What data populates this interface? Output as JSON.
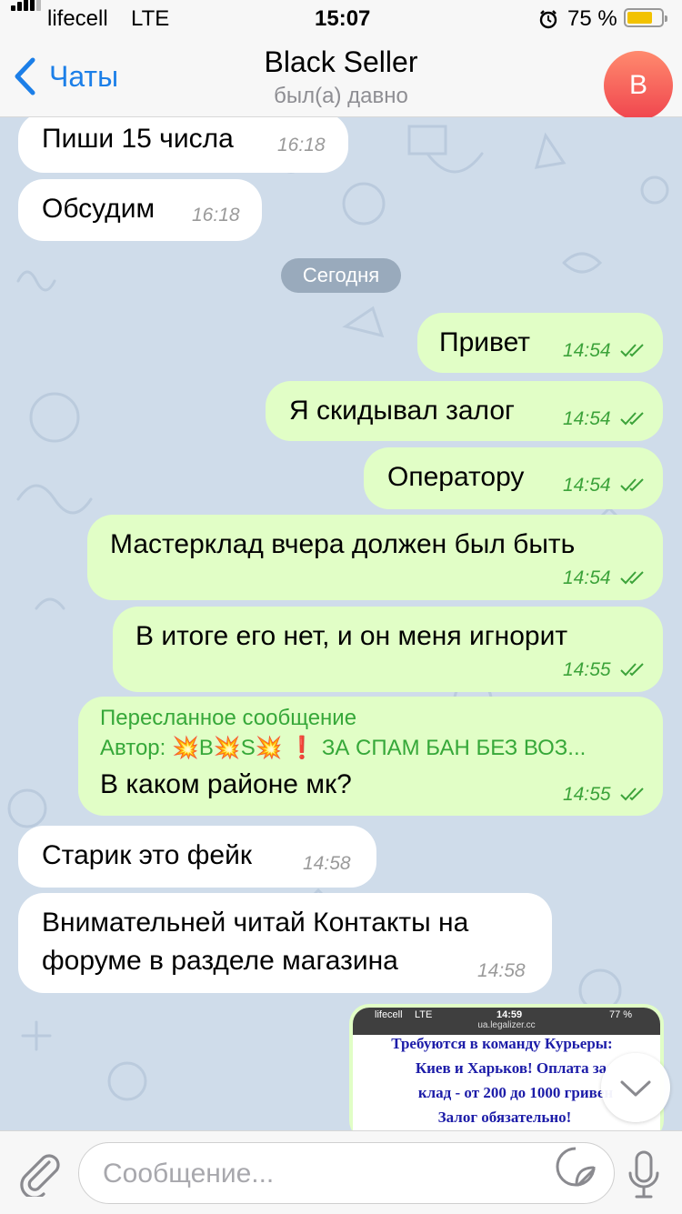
{
  "status_bar": {
    "carrier": "lifecell",
    "network": "LTE",
    "time": "15:07",
    "battery": "75 %",
    "battery_level": 0.75
  },
  "navbar": {
    "back_label": "Чаты",
    "title": "Black Seller",
    "subtitle": "был(а) давно",
    "avatar_letter": "B"
  },
  "date_separator": "Сегодня",
  "messages": [
    {
      "direction": "in",
      "text": "Пиши 15 числа",
      "time": "16:18"
    },
    {
      "direction": "in",
      "text": "Обсудим",
      "time": "16:18"
    },
    {
      "direction": "out",
      "text": "Привет",
      "time": "14:54",
      "read": true
    },
    {
      "direction": "out",
      "text": "Я скидывал залог",
      "time": "14:54",
      "read": true
    },
    {
      "direction": "out",
      "text": "Оператору",
      "time": "14:54",
      "read": true
    },
    {
      "direction": "out",
      "text": "Мастерклад вчера должен был быть",
      "time": "14:54",
      "read": true
    },
    {
      "direction": "out",
      "text": "В итоге его нет, и он меня игнорит",
      "time": "14:55",
      "read": true
    },
    {
      "direction": "out",
      "forwarded_label": "Пересланное сообщение",
      "forwarded_from": "Автор: 💥B💥S💥 ❗ ЗА СПАМ БАН БЕЗ ВОЗ...",
      "text": "В каком районе мк?",
      "time": "14:55",
      "read": true
    },
    {
      "direction": "in",
      "text": "Старик это фейк",
      "time": "14:58"
    },
    {
      "direction": "in",
      "lines": [
        "Внимательней читай Контакты на",
        "форуме в разделе магазина"
      ],
      "time": "14:58"
    }
  ],
  "media_preview": {
    "status_carrier": "lifecell",
    "status_network": "LTE",
    "status_time": "14:59",
    "status_battery": "77 %",
    "url": "ua.legalizer.cc",
    "lines": [
      "Требуются в команду Курьеры:",
      "Киев и Харьков! Оплата за",
      "клад - от 200 до 1000 гривен",
      "Залог обязательно!"
    ]
  },
  "input": {
    "placeholder": "Сообщение..."
  },
  "icons": [
    "back-chevron-icon",
    "paperclip-icon",
    "sticker-icon",
    "microphone-icon",
    "chevron-down-icon",
    "alarm-icon",
    "double-check-icon"
  ],
  "colors": {
    "accent": "#1c7fe8",
    "outgoing_bubble": "#e1fec6",
    "incoming_bubble": "#ffffff",
    "read_ticks": "#3ca33a",
    "forward_header": "#36a839"
  }
}
